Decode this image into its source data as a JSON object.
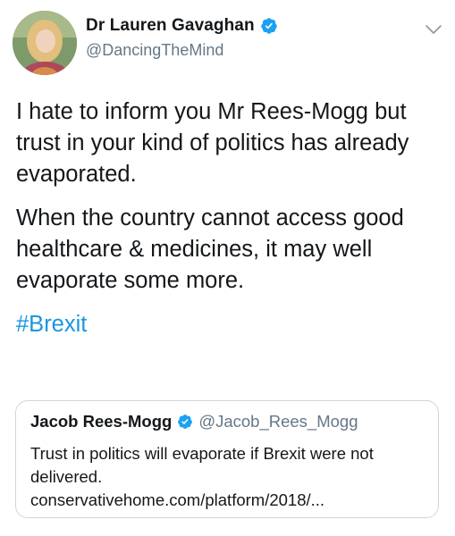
{
  "author": {
    "display_name": "Dr Lauren Gavaghan",
    "handle": "@DancingTheMind",
    "verified": true
  },
  "tweet": {
    "paragraphs": [
      "I hate to inform you Mr Rees-Mogg but trust in your kind of politics has already evaporated.",
      "When the country cannot access good healthcare & medicines, it may well evaporate some more."
    ],
    "hashtag": "#Brexit"
  },
  "quoted_tweet": {
    "display_name": "Jacob Rees-Mogg",
    "handle": "@Jacob_Rees_Mogg",
    "verified": true,
    "text": "Trust in politics will evaporate if Brexit were not delivered.",
    "link": "conservativehome.com/platform/2018/..."
  },
  "colors": {
    "verified_blue": "#1da1f2",
    "hashtag_blue": "#1b95e0",
    "secondary_text": "#657786",
    "border": "#ccd6dd"
  },
  "icons": {
    "verified": "verified-badge-icon",
    "more": "chevron-down-icon"
  }
}
